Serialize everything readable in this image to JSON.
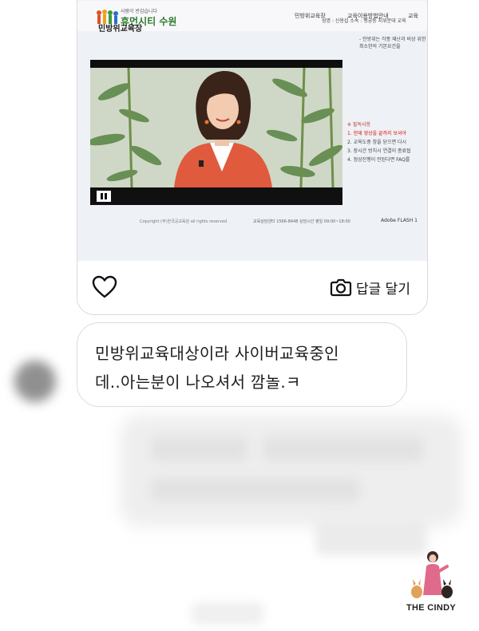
{
  "photo": {
    "logo_slogan": "사람이 반갑습니다",
    "logo_name": "휴먼시티 수원",
    "nav_items": [
      "민방위교육장",
      "교육이용방법안내",
      "교육"
    ],
    "page_heading": "민방위교육장",
    "page_meta": "성명 : 신용섭  소속 : 행궁동  지위분대  교육",
    "side_note": "- 민방위는 각종 재난과 비상 위한 최소한의 기본요건을",
    "notice_title": "※ 필독사항",
    "notice_items": [
      "1. 현재 영상을 끝까지 보셔야",
      "2. 교육도중 창을 닫으면 다시",
      "3. 장시간 방치시 연결이 종료됩",
      "4. 정상진행이 안된다면 FAQ를"
    ],
    "footer_left": "Copyright (주)한국공교육원 all rights reserved",
    "footer_mid": "교육상담센타 1566-8448  상담시간 평일 09:00~18:00",
    "footer_right": "Adobe FLASH 1"
  },
  "actions": {
    "like_icon": "heart-outline-icon",
    "reply_icon": "camera-icon",
    "reply_label": "답글 달기"
  },
  "message": {
    "line1": "민방위교육대상이라 사이버교육중인",
    "line2": "데..아는분이 나오셔서 깜놀.ㅋ"
  },
  "watermark": {
    "text": "THE CINDY"
  }
}
